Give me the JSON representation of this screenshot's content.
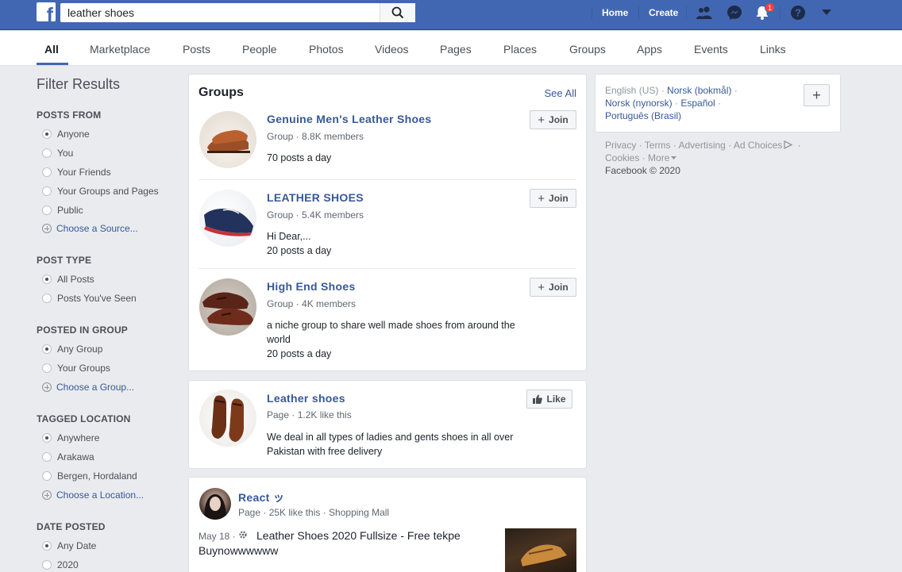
{
  "search": {
    "query": "leather shoes"
  },
  "topnav": {
    "home": "Home",
    "create": "Create",
    "notifications_count": "1"
  },
  "tabs": [
    "All",
    "Marketplace",
    "Posts",
    "People",
    "Photos",
    "Videos",
    "Pages",
    "Places",
    "Groups",
    "Apps",
    "Events",
    "Links"
  ],
  "filters": {
    "title": "Filter Results",
    "posts_from": {
      "heading": "POSTS FROM",
      "options": [
        "Anyone",
        "You",
        "Your Friends",
        "Your Groups and Pages",
        "Public"
      ],
      "link": "Choose a Source..."
    },
    "post_type": {
      "heading": "POST TYPE",
      "options": [
        "All Posts",
        "Posts You've Seen"
      ]
    },
    "posted_in_group": {
      "heading": "POSTED IN GROUP",
      "options": [
        "Any Group",
        "Your Groups"
      ],
      "link": "Choose a Group..."
    },
    "tagged_location": {
      "heading": "TAGGED LOCATION",
      "options": [
        "Anywhere",
        "Arakawa",
        "Bergen, Hordaland"
      ],
      "link": "Choose a Location..."
    },
    "date_posted": {
      "heading": "DATE POSTED",
      "options": [
        "Any Date",
        "2020"
      ]
    }
  },
  "groups_card": {
    "title": "Groups",
    "see_all": "See All",
    "join_label": "Join",
    "items": [
      {
        "name": "Genuine Men's Leather Shoes",
        "meta": "Group · 8.8K members",
        "line1": "70 posts a day",
        "line2": ""
      },
      {
        "name": "LEATHER SHOES",
        "meta": "Group · 5.4K members",
        "line1": "Hi Dear,...",
        "line2": "20 posts a day"
      },
      {
        "name": "High End Shoes",
        "meta": "Group · 4K members",
        "line1": "a niche group to share well made shoes from around the world",
        "line2": "20 posts a day"
      }
    ]
  },
  "page_card": {
    "name": "Leather shoes",
    "meta": "Page · 1.2K like this",
    "desc": "We deal in all types of ladies and gents shoes in all over Pakistan with free delivery",
    "like_label": "Like"
  },
  "post_card": {
    "author": "React ッ",
    "meta": "Page · 25K like this · Shopping Mall",
    "date": "May 18 ·",
    "text": "Leather Shoes 2020 Fullsize - Free tekpe Buynowwwwww"
  },
  "languages": {
    "current": "English (US)",
    "links": [
      "Norsk (bokmål)",
      "Norsk (nynorsk)",
      "Español",
      "Português (Brasil)"
    ]
  },
  "footer": {
    "links": [
      "Privacy",
      "Terms",
      "Advertising",
      "Ad Choices",
      "Cookies",
      "More"
    ],
    "copyright": "Facebook © 2020"
  },
  "colors": {
    "brand": "#4267b2",
    "link": "#365899",
    "background": "#e9ebee"
  }
}
